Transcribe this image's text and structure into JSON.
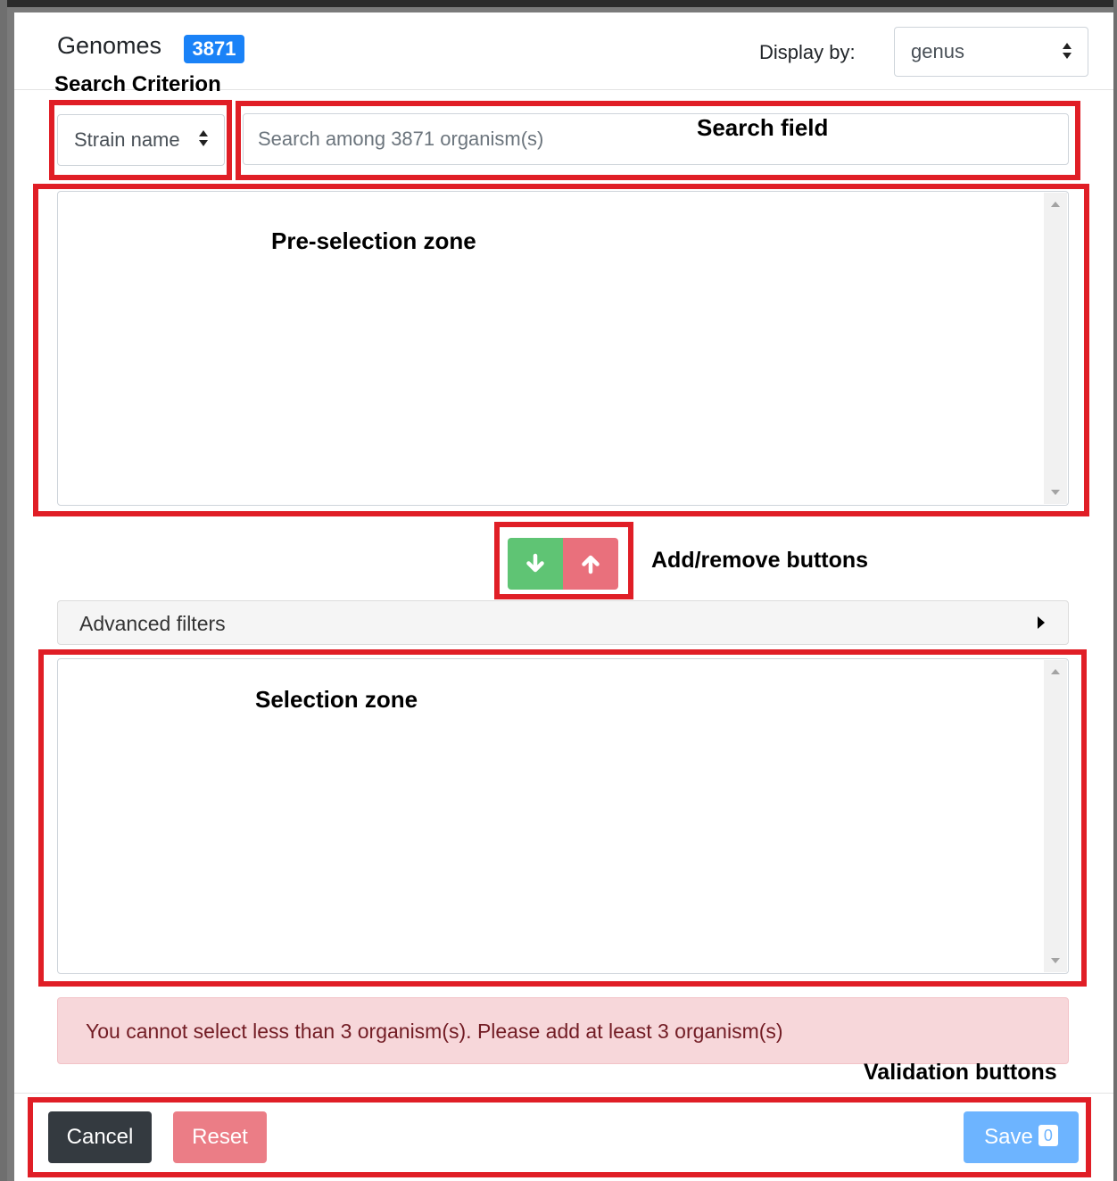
{
  "header": {
    "title": "Genomes",
    "count_badge": "3871",
    "display_by_label": "Display by:",
    "display_by_value": "genus"
  },
  "search": {
    "criterion_label": "Search Criterion",
    "criterion_value": "Strain name",
    "placeholder": "Search among 3871 organism(s)"
  },
  "advanced_filters": {
    "label": "Advanced filters"
  },
  "alert": {
    "message": "You cannot select less than 3 organism(s). Please add at least 3 organism(s)"
  },
  "footer": {
    "cancel_label": "Cancel",
    "reset_label": "Reset",
    "save_label": "Save",
    "save_count": "0"
  },
  "annotations": {
    "search_field": "Search field",
    "pre_selection_zone": "Pre-selection zone",
    "add_remove_buttons": "Add/remove buttons",
    "selection_zone": "Selection zone",
    "validation_buttons": "Validation buttons"
  },
  "colors": {
    "annotation_box": "#e01e26",
    "badge": "#1a82f7",
    "add_button": "#5fc474",
    "remove_button": "#e9707c",
    "cancel_button": "#343a40",
    "reset_button": "#eb7d86",
    "save_button": "#6db4ff",
    "alert_bg": "#f7d7da"
  },
  "icons": {
    "add": "arrow-down-icon",
    "remove": "arrow-up-icon",
    "select": "sort-updown-icon",
    "advanced": "caret-right-icon"
  }
}
